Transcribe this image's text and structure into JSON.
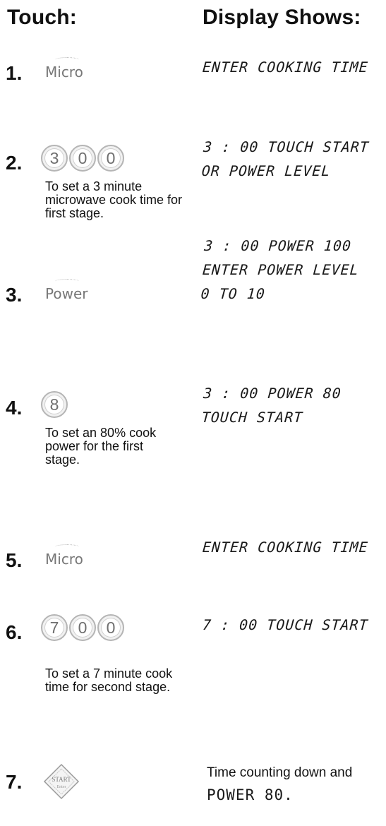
{
  "headers": {
    "touch": "Touch:",
    "display": "Display Shows:"
  },
  "steps": [
    {
      "number": "1.",
      "key_label": "Micro",
      "display": [
        "ENTER COOKING TIME"
      ]
    },
    {
      "number": "2.",
      "keys": [
        "3",
        "0",
        "0"
      ],
      "note": "To set a 3 minute microwave cook time for first stage.",
      "display": [
        "3 : 00 TOUCH START",
        "OR POWER LEVEL"
      ]
    },
    {
      "number": "3.",
      "key_label": "Power",
      "display": [
        "3 : 00 POWER 100",
        "ENTER POWER LEVEL",
        "0 TO 10"
      ]
    },
    {
      "number": "4.",
      "keys": [
        "8"
      ],
      "note": "To set an 80% cook power for the first stage.",
      "display": [
        "3 : 00 POWER 80",
        "TOUCH START"
      ]
    },
    {
      "number": "5.",
      "key_label": "Micro",
      "display": [
        "ENTER COOKING TIME"
      ]
    },
    {
      "number": "6.",
      "keys": [
        "7",
        "0",
        "0"
      ],
      "note": "To set a 7 minute cook time for second stage.",
      "display": [
        "7 : 00 TOUCH START"
      ]
    },
    {
      "number": "7.",
      "key_label": "START",
      "key_sublabel": "Enter",
      "display_text": "Time counting down and",
      "display": [
        "POWER 80."
      ]
    }
  ]
}
